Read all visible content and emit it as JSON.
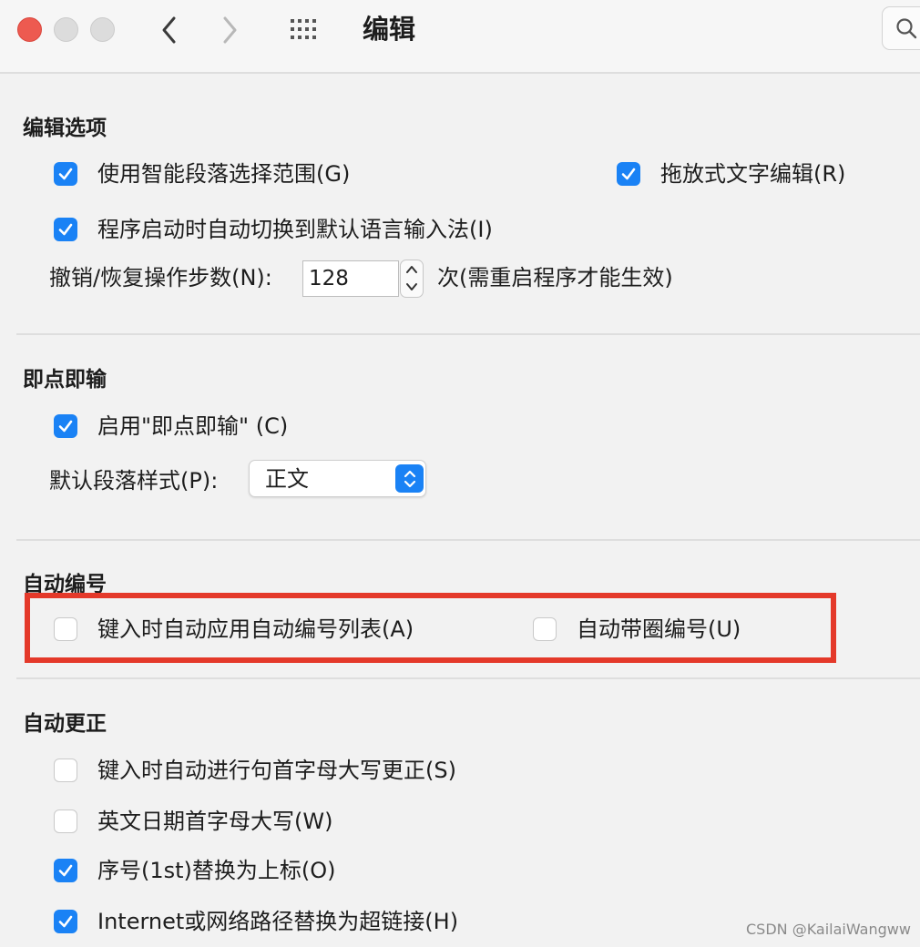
{
  "window": {
    "title": "编辑",
    "icons": [
      "close-dot",
      "minimize-dot",
      "zoom-dot",
      "back-chevron",
      "forward-chevron",
      "grid-icon",
      "search-icon"
    ]
  },
  "colors": {
    "accent": "#1a82f5",
    "close": "#ed5a50",
    "highlight": "#e4392a"
  },
  "editing_options": {
    "title": "编辑选项",
    "smart_paragraph": {
      "label": "使用智能段落选择范围(G)",
      "checked": true
    },
    "drag_drop": {
      "label": "拖放式文字编辑(R)",
      "checked": true
    },
    "auto_ime": {
      "label": "程序启动时自动切换到默认语言输入法(I)",
      "checked": true
    },
    "undo_label": "撤销/恢复操作步数(N):",
    "undo_value": "128",
    "undo_suffix": "次(需重启程序才能生效)"
  },
  "click_type": {
    "title": "即点即输",
    "enable": {
      "label": "启用\"即点即输\" (C)",
      "checked": true
    },
    "default_style_label": "默认段落样式(P):",
    "default_style_value": "正文"
  },
  "auto_numbering": {
    "title": "自动编号",
    "auto_list": {
      "label": "键入时自动应用自动编号列表(A)",
      "checked": false
    },
    "circled": {
      "label": "自动带圈编号(U)",
      "checked": false
    }
  },
  "auto_correct": {
    "title": "自动更正",
    "capitalize_sentence": {
      "label": "键入时自动进行句首字母大写更正(S)",
      "checked": false
    },
    "capitalize_dates": {
      "label": "英文日期首字母大写(W)",
      "checked": false
    },
    "ordinals": {
      "label": "序号(1st)替换为上标(O)",
      "checked": true
    },
    "hyperlinks": {
      "label": "Internet或网络路径替换为超链接(H)",
      "checked": true
    }
  },
  "watermark": "CSDN @KailaiWangww"
}
